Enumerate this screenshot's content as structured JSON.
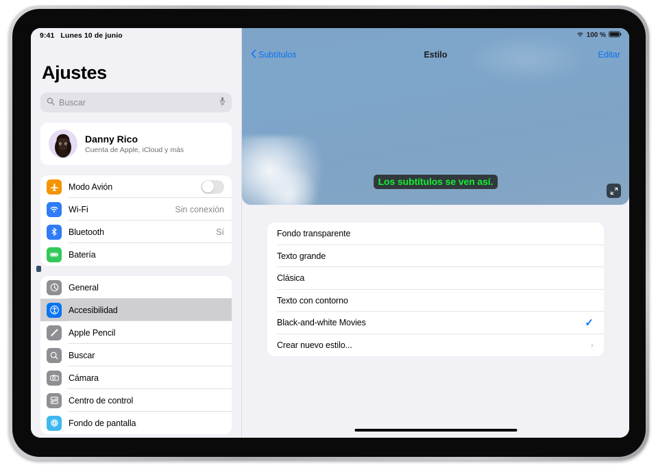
{
  "statusbar": {
    "time": "9:41",
    "date": "Lunes 10 de junio",
    "battery_percent": "100 %",
    "wifi_icon": "wifi-icon",
    "battery_icon": "battery-full-icon"
  },
  "sidebar": {
    "title": "Ajustes",
    "search": {
      "placeholder": "Buscar",
      "search_icon": "search-icon",
      "mic_icon": "microphone-icon"
    },
    "profile": {
      "name": "Danny Rico",
      "subtitle": "Cuenta de Apple, iCloud y más",
      "avatar_icon": "memoji-avatar"
    },
    "group1": [
      {
        "label": "Modo Avión",
        "icon": "airplane-icon",
        "icon_color": "#f59300",
        "control": "toggle",
        "toggle_on": false,
        "value": ""
      },
      {
        "label": "Wi-Fi",
        "icon": "wifi-icon",
        "icon_color": "#2f7cf6",
        "control": "value",
        "value": "Sin conexión"
      },
      {
        "label": "Bluetooth",
        "icon": "bluetooth-icon",
        "icon_color": "#2f7cf6",
        "control": "value",
        "value": "Sí"
      },
      {
        "label": "Batería",
        "icon": "battery-icon",
        "icon_color": "#34c759",
        "control": "none",
        "value": ""
      }
    ],
    "group2": [
      {
        "label": "General",
        "icon": "gear-icon",
        "icon_color": "#8e8e93",
        "selected": false
      },
      {
        "label": "Accesibilidad",
        "icon": "accessibility-icon",
        "icon_color": "#0a74f0",
        "selected": true
      },
      {
        "label": "Apple Pencil",
        "icon": "pencil-icon",
        "icon_color": "#8e8e93",
        "selected": false
      },
      {
        "label": "Buscar",
        "icon": "search-icon",
        "icon_color": "#8e8e93",
        "selected": false
      },
      {
        "label": "Cámara",
        "icon": "camera-icon",
        "icon_color": "#8e8e93",
        "selected": false
      },
      {
        "label": "Centro de control",
        "icon": "control-center-icon",
        "icon_color": "#8e8e93",
        "selected": false
      },
      {
        "label": "Fondo de pantalla",
        "icon": "wallpaper-icon",
        "icon_color": "#3fb8ef",
        "selected": false
      }
    ]
  },
  "detail": {
    "nav": {
      "back_label": "Subtítulos",
      "back_icon": "chevron-left-icon",
      "title": "Estilo",
      "edit_label": "Editar"
    },
    "preview": {
      "caption_text": "Los subtítulos se ven así.",
      "caption_color": "#13f034",
      "caption_background": "#31393c",
      "expand_icon": "expand-arrows-icon"
    },
    "options": [
      {
        "label": "Fondo transparente",
        "accessory": "none"
      },
      {
        "label": "Texto grande",
        "accessory": "none"
      },
      {
        "label": "Clásica",
        "accessory": "none"
      },
      {
        "label": "Texto con contorno",
        "accessory": "none"
      },
      {
        "label": "Black-and-white Movies",
        "accessory": "check"
      },
      {
        "label": "Crear nuevo estilo...",
        "accessory": "chevron"
      }
    ],
    "checkmark_glyph": "✓",
    "chevron_glyph": "›"
  },
  "colors": {
    "accent": "#0a74f0",
    "selected_row": "#cfced3",
    "page_background": "#f2f1f6"
  }
}
